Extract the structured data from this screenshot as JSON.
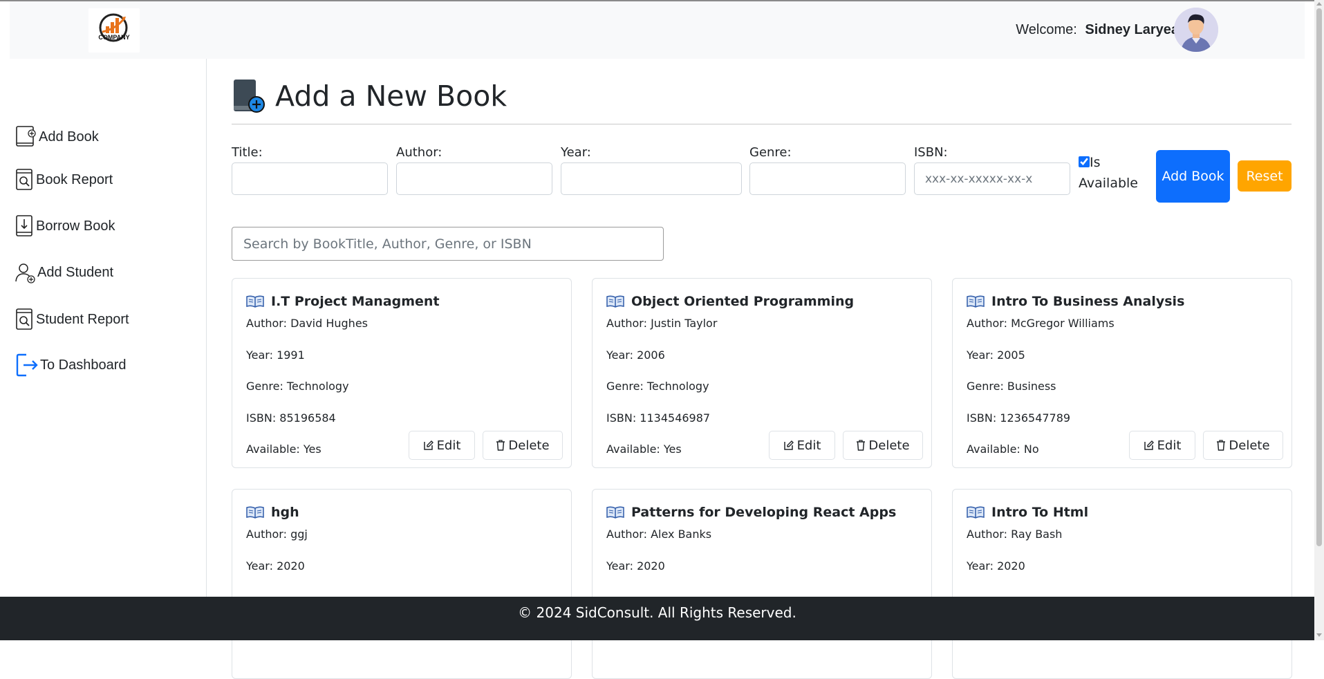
{
  "header": {
    "logo_text": "COMPANY",
    "welcome_label": "Welcome:",
    "user_name": "Sidney Laryea"
  },
  "sidebar": {
    "items": [
      {
        "label": "Add Book",
        "icon": "add-book-icon"
      },
      {
        "label": "Book Report",
        "icon": "book-report-icon"
      },
      {
        "label": "Borrow Book",
        "icon": "borrow-book-icon"
      },
      {
        "label": "Add Student",
        "icon": "add-student-icon"
      },
      {
        "label": "Student Report",
        "icon": "student-report-icon"
      },
      {
        "label": "To Dashboard",
        "icon": "dashboard-exit-icon"
      }
    ]
  },
  "main": {
    "title": "Add a New Book",
    "form": {
      "title_label": "Title:",
      "author_label": "Author:",
      "year_label": "Year:",
      "genre_label": "Genre:",
      "isbn_label": "ISBN:",
      "isbn_placeholder": "xxx-xx-xxxxx-xx-x",
      "available_label": "Is Available",
      "available_checked": true,
      "add_button": "Add Book",
      "reset_button": "Reset"
    },
    "search_placeholder": "Search by BookTitle, Author, Genre, or ISBN",
    "edit_label": "Edit",
    "delete_label": "Delete",
    "books": [
      {
        "title": "I.T Project Managment",
        "author": "Author: David Hughes",
        "year": "Year: 1991",
        "genre": "Genre: Technology",
        "isbn": "ISBN: 85196584",
        "available": "Available: Yes"
      },
      {
        "title": "Object Oriented Programming",
        "author": "Author: Justin Taylor",
        "year": "Year: 2006",
        "genre": "Genre: Technology",
        "isbn": "ISBN: 1134546987",
        "available": "Available: Yes"
      },
      {
        "title": "Intro To Business Analysis",
        "author": "Author: McGregor Williams",
        "year": "Year: 2005",
        "genre": "Genre: Business",
        "isbn": "ISBN: 1236547789",
        "available": "Available: No"
      },
      {
        "title": "hgh",
        "author": "Author: ggj",
        "year": "Year: 2020"
      },
      {
        "title": "Patterns for Developing React Apps",
        "author": "Author: Alex Banks",
        "year": "Year: 2020"
      },
      {
        "title": "Intro To Html",
        "author": "Author: Ray Bash",
        "year": "Year: 2020"
      }
    ]
  },
  "footer": {
    "text": "© 2024 SidConsult. All Rights Reserved."
  },
  "colors": {
    "primary": "#0d6efd",
    "reset": "#ffa500",
    "footer_bg": "#212529"
  }
}
